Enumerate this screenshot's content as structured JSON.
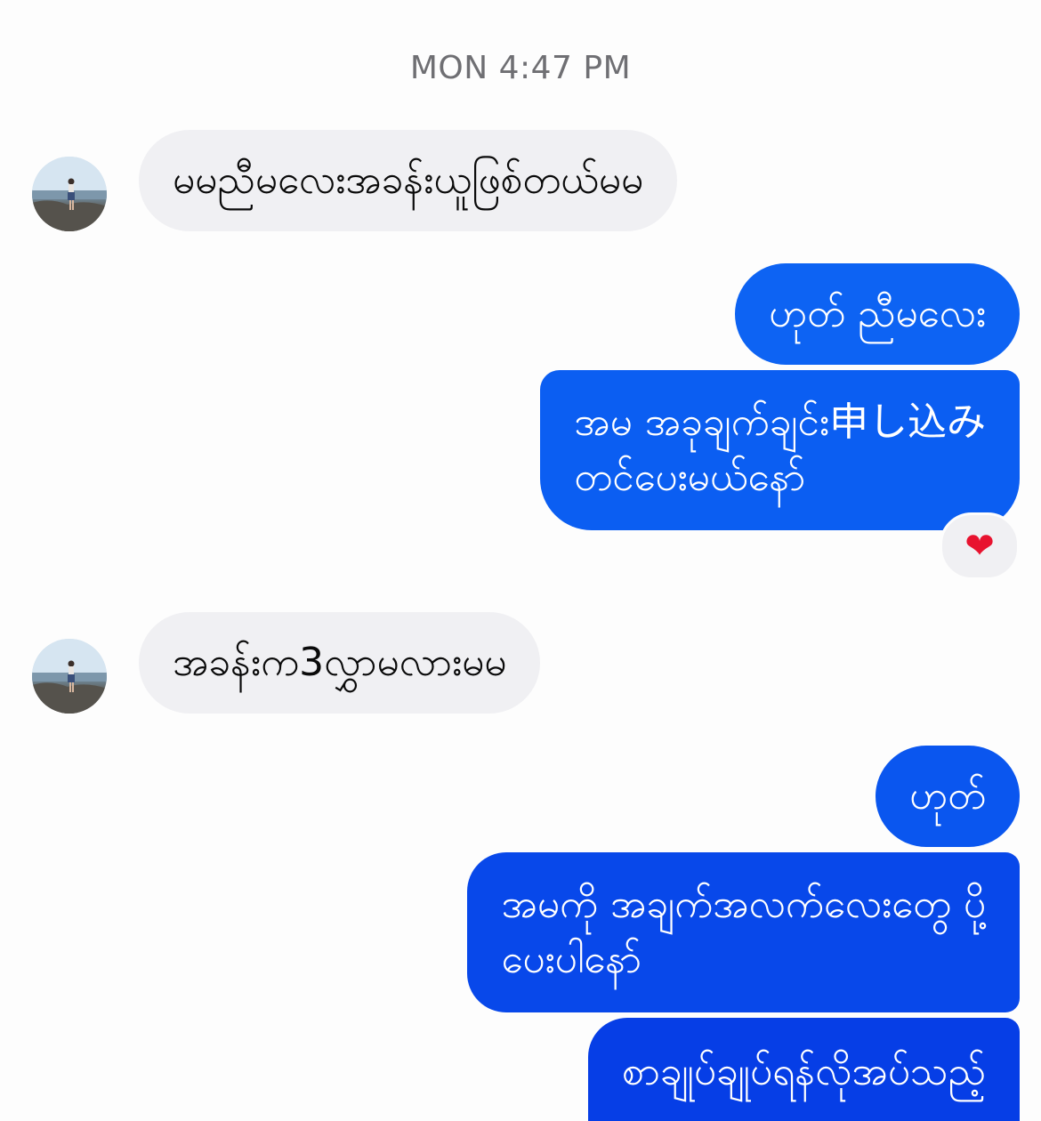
{
  "timestamp": "MON 4:47 PM",
  "messages": [
    {
      "sender": "them",
      "text": "မမညီမလေးအခန်းယူဖြစ်တယ်မမ"
    },
    {
      "sender": "me",
      "text": "ဟုတ် ညီမလေး"
    },
    {
      "sender": "me",
      "lines": [
        "အမ အခုချက်ချင်း申し込み",
        "တင်ပေးမယ်နော်"
      ],
      "reaction": "❤"
    },
    {
      "sender": "them",
      "text": "အခန်းက3လွှာမလားမမ"
    },
    {
      "sender": "me",
      "text": "ဟုတ်"
    },
    {
      "sender": "me",
      "lines": [
        "အမကို အချက်အလက်လေးတွေ ပို့",
        "ပေးပါနော်"
      ]
    },
    {
      "sender": "me",
      "lines": [
        "စာချုပ်ချုပ်ရန်လိုအပ်သည့်"
      ]
    }
  ],
  "colors": {
    "outgoing_bubble": "#0d63f3",
    "incoming_bubble": "#f0f0f3",
    "timestamp": "#6f6f73",
    "reaction_heart": "#e8132f"
  },
  "icons": {
    "avatar": "contact-photo",
    "reaction": "heart-emoji"
  }
}
